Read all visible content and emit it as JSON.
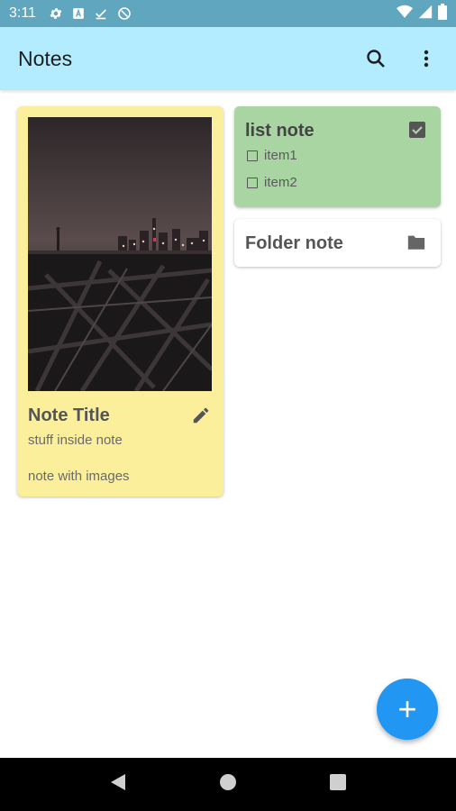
{
  "status_bar": {
    "time": "3:11",
    "icons": [
      "settings-icon",
      "font-icon",
      "download-done-icon",
      "do-not-disturb-icon",
      "wifi-icon",
      "signal-icon",
      "battery-icon"
    ]
  },
  "app_bar": {
    "title": "Notes",
    "actions": [
      "search-icon",
      "more-vert-icon"
    ]
  },
  "notes": [
    {
      "type": "image",
      "color": "#fbef9b",
      "title": "Note Title",
      "body": "stuff inside note",
      "footer": "note with images",
      "icon": "edit-icon"
    },
    {
      "type": "list",
      "color": "#a8d5a2",
      "title": "list note",
      "icon": "checkbox-checked-icon",
      "items": [
        {
          "label": "item1",
          "checked": false
        },
        {
          "label": "item2",
          "checked": false
        }
      ]
    },
    {
      "type": "folder",
      "color": "#ffffff",
      "title": "Folder note",
      "icon": "folder-icon"
    }
  ],
  "fab": {
    "label": "+",
    "icon": "add-icon",
    "color": "#2196f3"
  },
  "navigation": [
    "back-icon",
    "home-icon",
    "recents-icon"
  ],
  "colors": {
    "status_bar": "#5fa6be",
    "app_bar": "#b3ecff"
  }
}
